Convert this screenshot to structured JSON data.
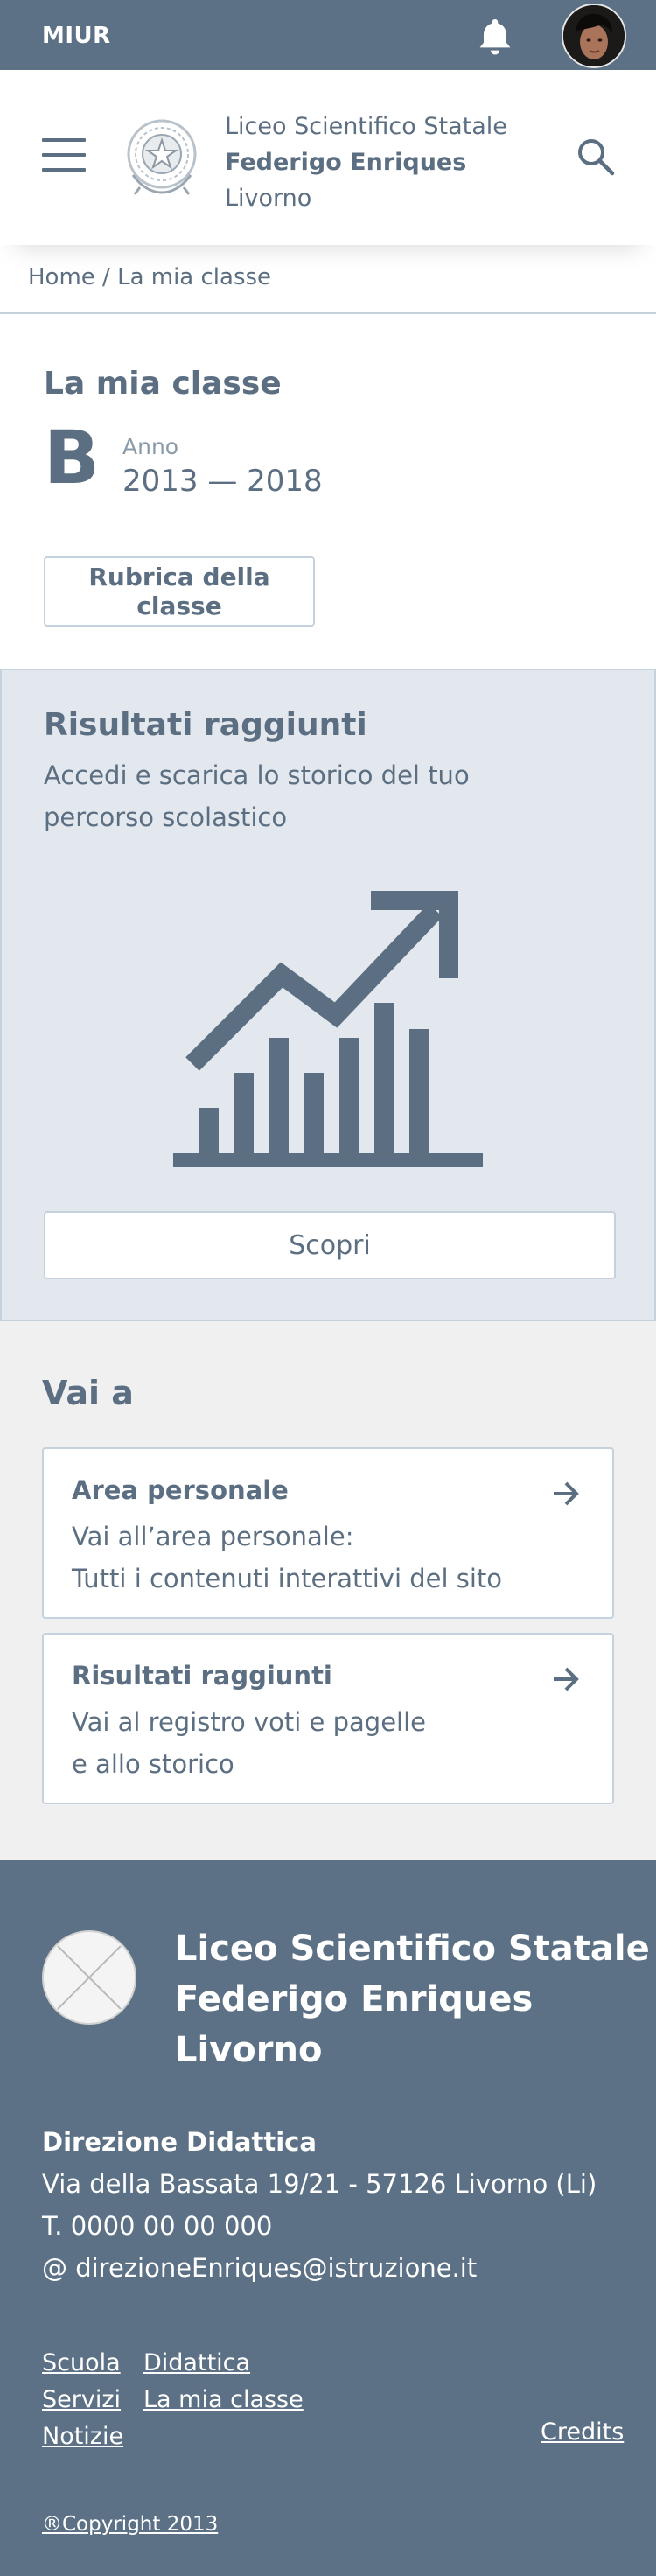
{
  "topbar": {
    "brand": "MIUR",
    "bg_color": "#5c7185"
  },
  "header": {
    "school_line1": "Liceo Scientifico Statale",
    "school_line2": "Federigo Enriques",
    "school_line3": "Livorno"
  },
  "breadcrumb": {
    "home": "Home",
    "separator": " / ",
    "current": "La mia classe"
  },
  "class_section": {
    "title": "La mia classe",
    "letter": "B",
    "year_label": "Anno",
    "year_value": "2013 — 2018",
    "rubrica_button": "Rubrica della classe"
  },
  "results": {
    "title": "Risultati raggiunti",
    "description": "Accedi e scarica lo storico del tuo percorso scolastico",
    "button": "Scopri",
    "icon": "growth-chart-icon"
  },
  "vai_a": {
    "title": "Vai a",
    "cards": [
      {
        "title": "Area personale",
        "text": "Vai all’area personale:\nTutti i contenuti interattivi del sito",
        "icon": "arrow-right-icon"
      },
      {
        "title": "Risultati raggiunti",
        "text": "Vai al registro voti e pagelle\ne allo storico",
        "icon": "arrow-right-icon"
      }
    ]
  },
  "footer": {
    "name_line1": "Liceo Scientifico Statale",
    "name_line2": "Federigo Enriques",
    "name_line3": "Livorno",
    "office_title": "Direzione Didattica",
    "address": "Via della Bassata 19/21 - 57126 Livorno (Li)",
    "phone": "T. 0000 00 00 000",
    "email": "@ direzioneEnriques@istruzione.it",
    "links_col1": [
      "Scuola",
      "Servizi",
      "Notizie"
    ],
    "links_col2": [
      "Didattica",
      "La mia classe"
    ],
    "credits": "Credits",
    "copyright": "®Copyright 2013"
  }
}
